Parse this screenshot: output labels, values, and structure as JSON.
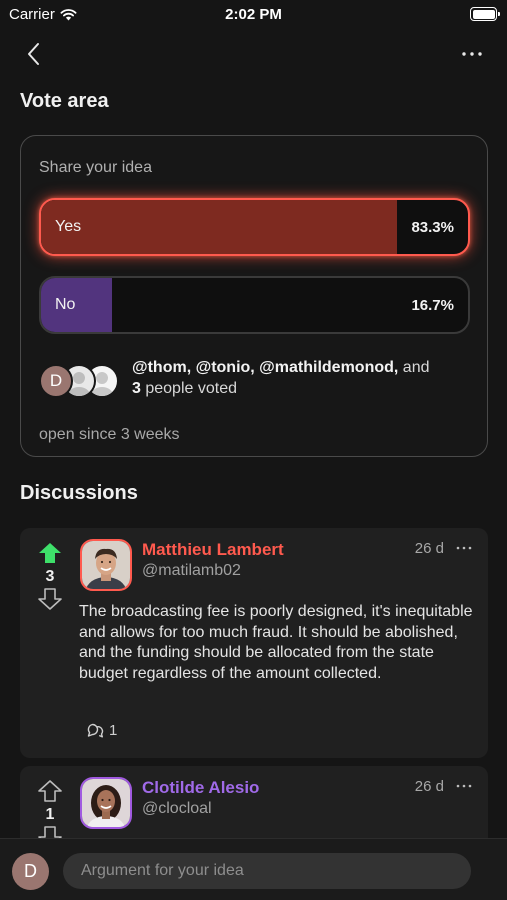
{
  "status_bar": {
    "carrier": "Carrier",
    "time": "2:02 PM"
  },
  "vote_area": {
    "title": "Vote area",
    "prompt": "Share your idea",
    "options": [
      {
        "label": "Yes",
        "percent_text": "83.3%",
        "percent": 83.3
      },
      {
        "label": "No",
        "percent_text": "16.7%",
        "percent": 16.7
      }
    ],
    "voters": {
      "avatar_initial": "D",
      "names": "@thom, @tonio, @mathildemonod,",
      "and_text": " and",
      "count": "3",
      "suffix": " people voted"
    },
    "open_since": "open since 3 weeks"
  },
  "discussions": {
    "title": "Discussions",
    "comments": [
      {
        "name": "Matthieu Lambert",
        "handle": "@matilamb02",
        "time": "26 d",
        "score": "3",
        "upvoted": true,
        "body": "The broadcasting fee is poorly designed, it's inequitable and allows for too much fraud. It should be abolished, and the funding should be allocated from the state budget regardless of the amount collected.",
        "replies": "1"
      },
      {
        "name": "Clotilde Alesio",
        "handle": "@clocloal",
        "time": "26 d",
        "score": "1",
        "upvoted": false
      }
    ]
  },
  "composer": {
    "avatar_initial": "D",
    "placeholder": "Argument for your idea"
  },
  "colors": {
    "accent_red": "#ff5a4e",
    "accent_purple": "#a06ae8",
    "upvote_green": "#3ee06a"
  },
  "icons": [
    "wifi-icon",
    "battery-icon",
    "back-chevron-icon",
    "more-horizontal-icon",
    "upvote-arrow-icon",
    "downvote-arrow-icon",
    "comment-bubble-icon"
  ]
}
